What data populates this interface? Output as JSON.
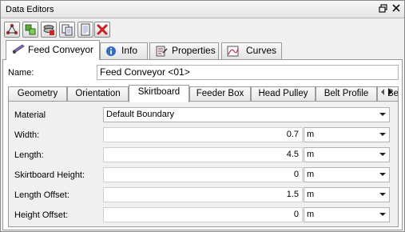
{
  "window": {
    "title": "Data Editors"
  },
  "top_tabs": [
    {
      "label": "Feed Conveyor",
      "active": true,
      "icon": "conveyor-icon"
    },
    {
      "label": "Info",
      "active": false,
      "icon": "info-icon"
    },
    {
      "label": "Properties",
      "active": false,
      "icon": "properties-icon"
    },
    {
      "label": "Curves",
      "active": false,
      "icon": "curves-icon"
    }
  ],
  "name": {
    "label": "Name:",
    "value": "Feed Conveyor <01>"
  },
  "sub_tabs": [
    {
      "label": "Geometry",
      "active": false
    },
    {
      "label": "Orientation",
      "active": false
    },
    {
      "label": "Skirtboard",
      "active": true
    },
    {
      "label": "Feeder Box",
      "active": false
    },
    {
      "label": "Head Pulley",
      "active": false
    },
    {
      "label": "Belt Profile",
      "active": false
    },
    {
      "label": "Belt",
      "active": false
    }
  ],
  "skirtboard": {
    "material": {
      "label": "Material",
      "value": "Default Boundary"
    },
    "fields": [
      {
        "label": "Width:",
        "value": "0.7",
        "unit": "m"
      },
      {
        "label": "Length:",
        "value": "4.5",
        "unit": "m"
      },
      {
        "label": "Skirtboard Height:",
        "value": "0",
        "unit": "m"
      },
      {
        "label": "Length Offset:",
        "value": "1.5",
        "unit": "m"
      },
      {
        "label": "Height Offset:",
        "value": "0",
        "unit": "m"
      }
    ]
  },
  "colors": {
    "accent_red": "#d02020",
    "panel_bg": "#f0f0f0",
    "border": "#9a9a9a"
  }
}
